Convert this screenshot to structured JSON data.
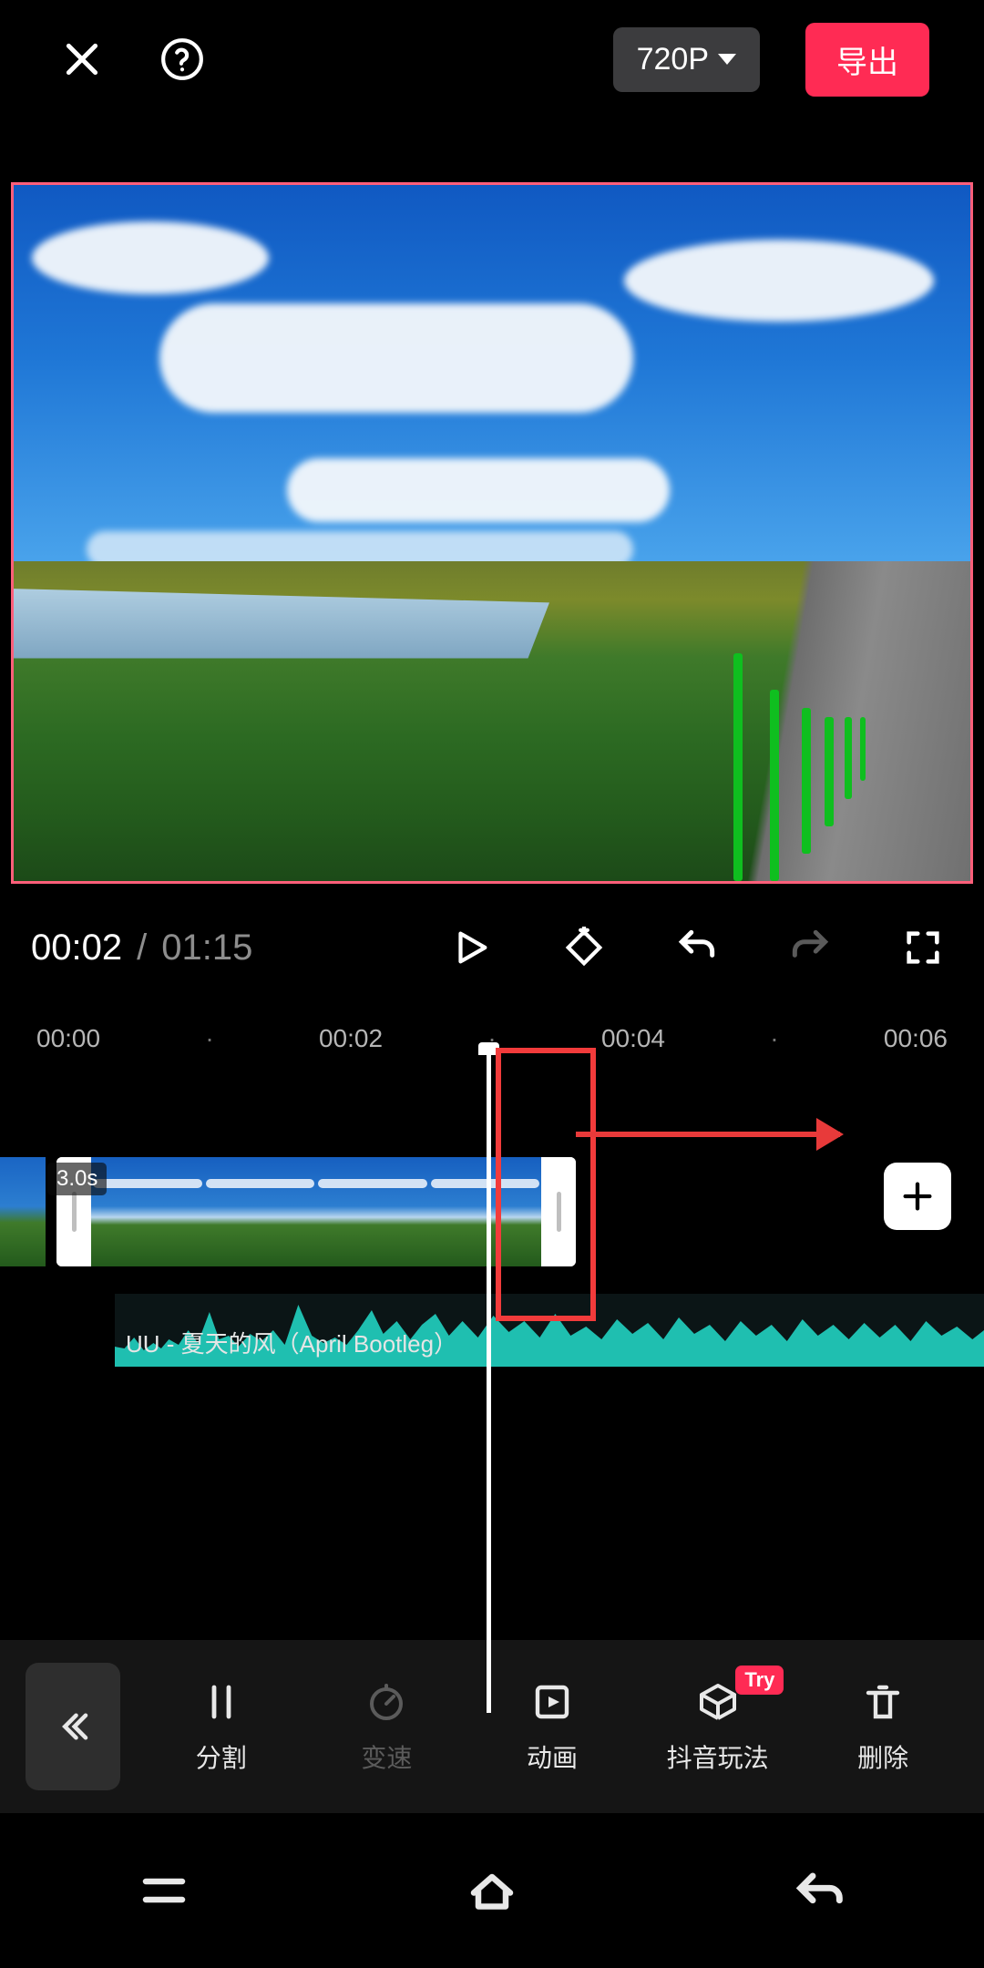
{
  "header": {
    "resolution_label": "720P",
    "export_label": "导出"
  },
  "transport": {
    "current_time": "00:02",
    "separator": "/",
    "total_time": "01:15"
  },
  "ruler": {
    "marks": [
      "00:00",
      "·",
      "00:02",
      "·",
      "00:04",
      "·",
      "00:06"
    ]
  },
  "clip": {
    "duration_label": "3.0s"
  },
  "audio": {
    "label": "UU - 夏天的风（April Bootleg）"
  },
  "tools": {
    "items": [
      {
        "key": "split",
        "label": "分割"
      },
      {
        "key": "speed",
        "label": "变速"
      },
      {
        "key": "anim",
        "label": "动画"
      },
      {
        "key": "douyin",
        "label": "抖音玩法",
        "badge": "Try"
      },
      {
        "key": "delete",
        "label": "删除"
      }
    ]
  },
  "colors": {
    "accent": "#ff2b54",
    "annotation": "#f23b3b",
    "wave": "#1fbfb0"
  }
}
